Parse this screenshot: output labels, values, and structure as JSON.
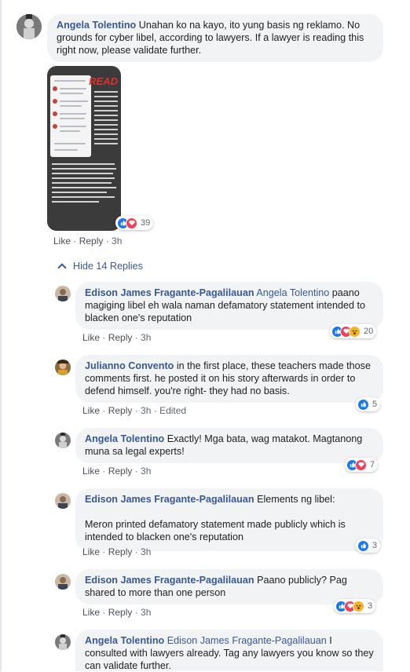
{
  "thread": {
    "main_comment": {
      "author": "Angela Tolentino",
      "text": " Unahan ko na kayo, ito yung basis ng reklamo. No grounds for cyber libel, according to lawyers. If a lawyer is reading this right now, please validate further.",
      "photo_overlay_text": "READ",
      "reactions": [
        "like",
        "love"
      ],
      "reaction_count": "39",
      "actions": {
        "like": "Like",
        "reply": "Reply",
        "time": "3h"
      }
    },
    "hide_replies_label": "Hide 14 Replies",
    "replies": [
      {
        "author": "Edison James Fragante-Pagalilauan",
        "mention": "Angela Tolentino",
        "text": " paano magiging libel eh wala naman defamatory statement intended to blacken one's reputation",
        "reactions": [
          "like",
          "love",
          "wow"
        ],
        "reaction_count": "20",
        "actions": {
          "like": "Like",
          "reply": "Reply",
          "time": "3h"
        }
      },
      {
        "author": "Julianno Convento",
        "mention": "",
        "text": " in the first place, these teachers made those comments first. he posted it on his story afterwards in order to defend himself. you're right- they had no basis.",
        "reactions": [
          "like"
        ],
        "reaction_count": "5",
        "actions": {
          "like": "Like",
          "reply": "Reply",
          "time": "3h",
          "edited": "Edited"
        }
      },
      {
        "author": "Angela Tolentino",
        "mention": "",
        "text": " Exactly! Mga bata, wag matakot. Magtanong muna sa legal experts!",
        "reactions": [
          "like",
          "love"
        ],
        "reaction_count": "7",
        "actions": {
          "like": "Like",
          "reply": "Reply",
          "time": "3h"
        }
      },
      {
        "author": "Edison James Fragante-Pagalilauan",
        "mention": "",
        "text": " Elements ng libel:",
        "text2": "Meron printed defamatory statement made publicly which is intended to blacken one's reputation",
        "reactions": [
          "like"
        ],
        "reaction_count": "3",
        "actions": {
          "like": "Like",
          "reply": "Reply",
          "time": "3h"
        }
      },
      {
        "author": "Edison James Fragante-Pagalilauan",
        "mention": "",
        "text": " Paano publicly? Pag shared to more than one person",
        "reactions": [
          "like",
          "love",
          "wow"
        ],
        "reaction_count": "3",
        "actions": {
          "like": "Like",
          "reply": "Reply",
          "time": "3h"
        }
      },
      {
        "author": "Angela Tolentino",
        "mention": "Edison James Fragante-Pagalilauan",
        "text": " I consulted with lawyers already. Tag any lawyers you know so they can validate further."
      }
    ]
  },
  "colors": {
    "link": "#385898",
    "bubble": "#f2f3f5",
    "like": "#1877f2",
    "love": "#f33e58",
    "wow": "#f7b125"
  }
}
